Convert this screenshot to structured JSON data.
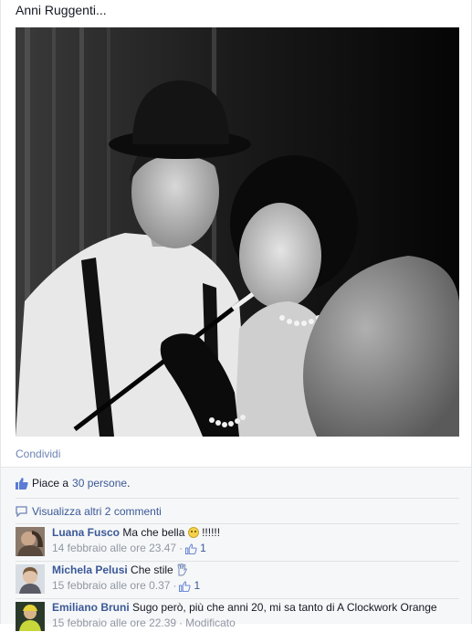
{
  "post": {
    "caption": "Anni Ruggenti...",
    "photo_alt": "Foto",
    "share_label": "Condividi"
  },
  "likes": {
    "prefix": "Piace a",
    "count_link": "30 persone",
    "suffix": "."
  },
  "more_comments": {
    "label": "Visualizza altri 2 commenti"
  },
  "comments": [
    {
      "author": "Luana Fusco",
      "text": "Ma che bella",
      "text_after": "!!!!!!",
      "timestamp": "14 febbraio alle ore 23.47",
      "separator": "·",
      "like_count": "1"
    },
    {
      "author": "Michela Pelusi",
      "text": "Che stile",
      "timestamp": "15 febbraio alle ore 0.37",
      "separator": "·",
      "like_count": "1"
    },
    {
      "author": "Emiliano Bruni",
      "text": "Sugo però, più che anni 20, mi sa tanto di A Clockwork Orange",
      "timestamp": "15 febbraio alle ore 22.39",
      "separator": "·",
      "edited": "Modificato"
    }
  ],
  "icons": {
    "thumbs_up": "thumbs-up-icon",
    "comment_bubble": "comment-bubble-icon",
    "smile": "smile-emoji-icon",
    "hand": "hand-emoji-icon"
  },
  "colors": {
    "link": "#3b5998",
    "text": "#141823",
    "meta": "#9197a3",
    "ufi_bg": "#f6f7f8"
  }
}
